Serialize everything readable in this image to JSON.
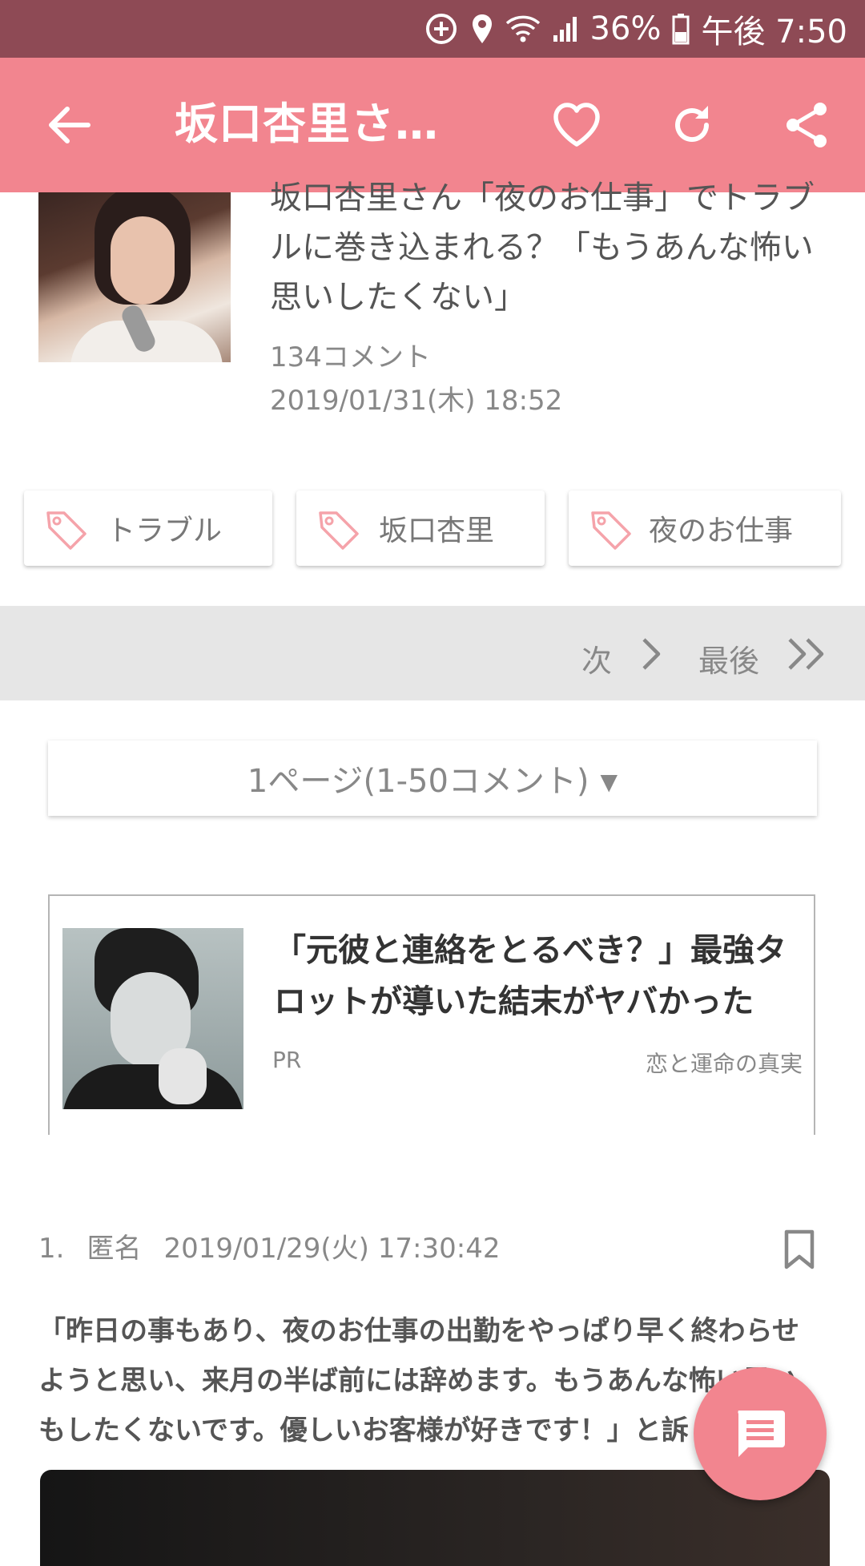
{
  "status_bar": {
    "battery": "36%",
    "time": "午後 7:50"
  },
  "app_bar": {
    "title": "坂口杏里さ…",
    "icons": [
      "back-arrow-icon",
      "heart-icon",
      "refresh-icon",
      "share-icon"
    ]
  },
  "article": {
    "title": "坂口杏里さん「夜のお仕事」でトラブルに巻き込まれる？「もうあんな怖い思いしたくない」",
    "comments": "134コメント",
    "date": "2019/01/31(木) 18:52"
  },
  "tags": [
    {
      "label": "トラブル"
    },
    {
      "label": "坂口杏里"
    },
    {
      "label": "夜のお仕事"
    }
  ],
  "pager": {
    "next": "次",
    "last": "最後"
  },
  "page_select": {
    "value": "1ページ(1-50コメント)",
    "arrow": "▼"
  },
  "ad": {
    "title": "「元彼と連絡をとるべき？」最強タロットが導いた結末がヤバかった",
    "pr": "PR",
    "source": "恋と運命の真実"
  },
  "comment": {
    "number": "1.",
    "author": "匿名",
    "date": "2019/01/29(火) 17:30:42",
    "body": "「昨日の事もあり、夜のお仕事の出勤をやっぱり早く終わらせようと思い、来月の半ば前には辞めます。もうあんな怖い思いもしたくないです。優しいお客様が好きです！」と訴"
  },
  "colors": {
    "status_bar": "#8e4a55",
    "app_bar": "#f2858f",
    "accent": "#f2858f"
  }
}
